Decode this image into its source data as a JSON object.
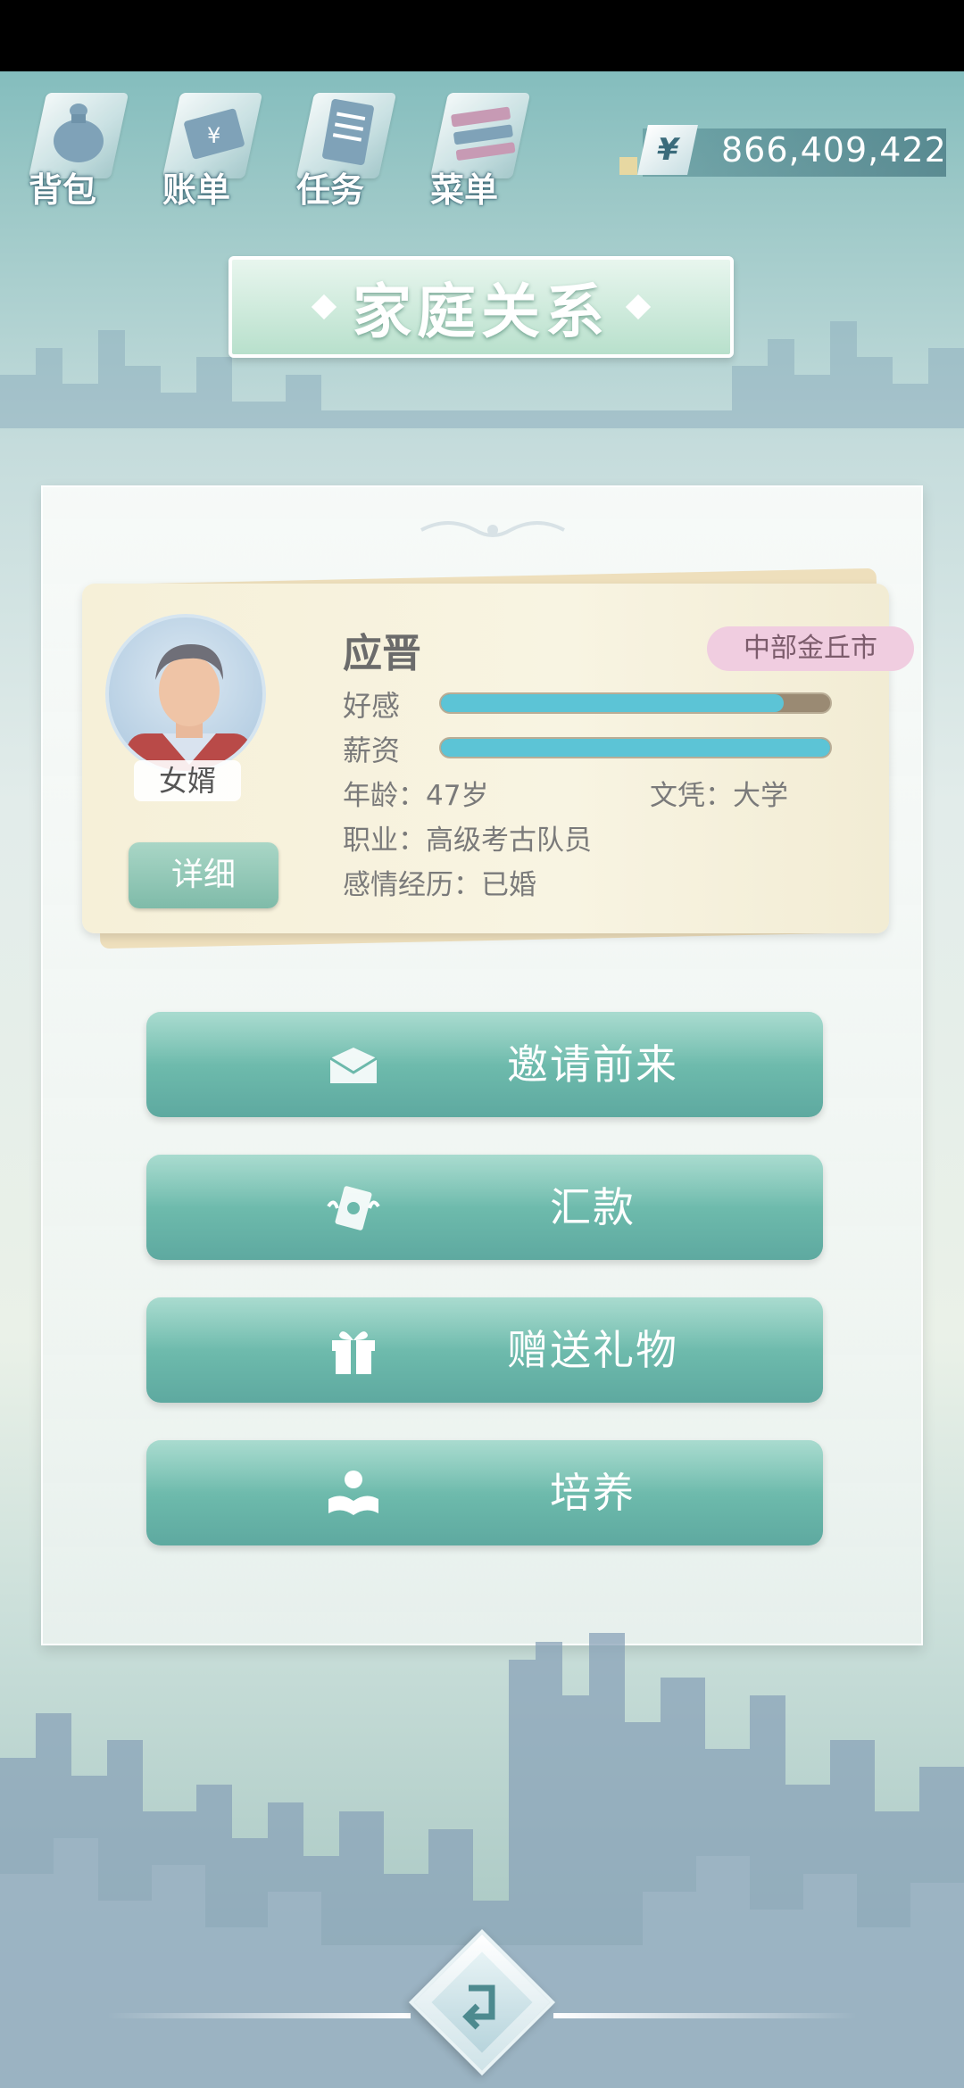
{
  "nav": {
    "items": [
      {
        "label": "背包",
        "icon": "bag-icon"
      },
      {
        "label": "账单",
        "icon": "bill-icon"
      },
      {
        "label": "任务",
        "icon": "task-icon"
      },
      {
        "label": "菜单",
        "icon": "menu-icon"
      }
    ]
  },
  "currency": {
    "symbol": "¥",
    "amount": "866,409,422"
  },
  "page": {
    "title": "家庭关系"
  },
  "profile": {
    "name": "应晋",
    "region": "中部金丘市",
    "relation": "女婿",
    "detail_label": "详细",
    "favor_label": "好感",
    "favor_value": 0.88,
    "salary_label": "薪资",
    "salary_value": 1.0,
    "age": "年龄：47岁",
    "education": "文凭：大学",
    "occupation": "职业：高级考古队员",
    "relationship": "感情经历：已婚"
  },
  "actions": [
    {
      "label": "邀请前来",
      "icon": "envelope-icon"
    },
    {
      "label": "汇款",
      "icon": "money-icon"
    },
    {
      "label": "赠送礼物",
      "icon": "gift-icon"
    },
    {
      "label": "培养",
      "icon": "study-icon"
    }
  ],
  "colors": {
    "accent": "#6cb9ab",
    "bar_fill": "#5cc4d6",
    "badge": "#f0cde0"
  }
}
